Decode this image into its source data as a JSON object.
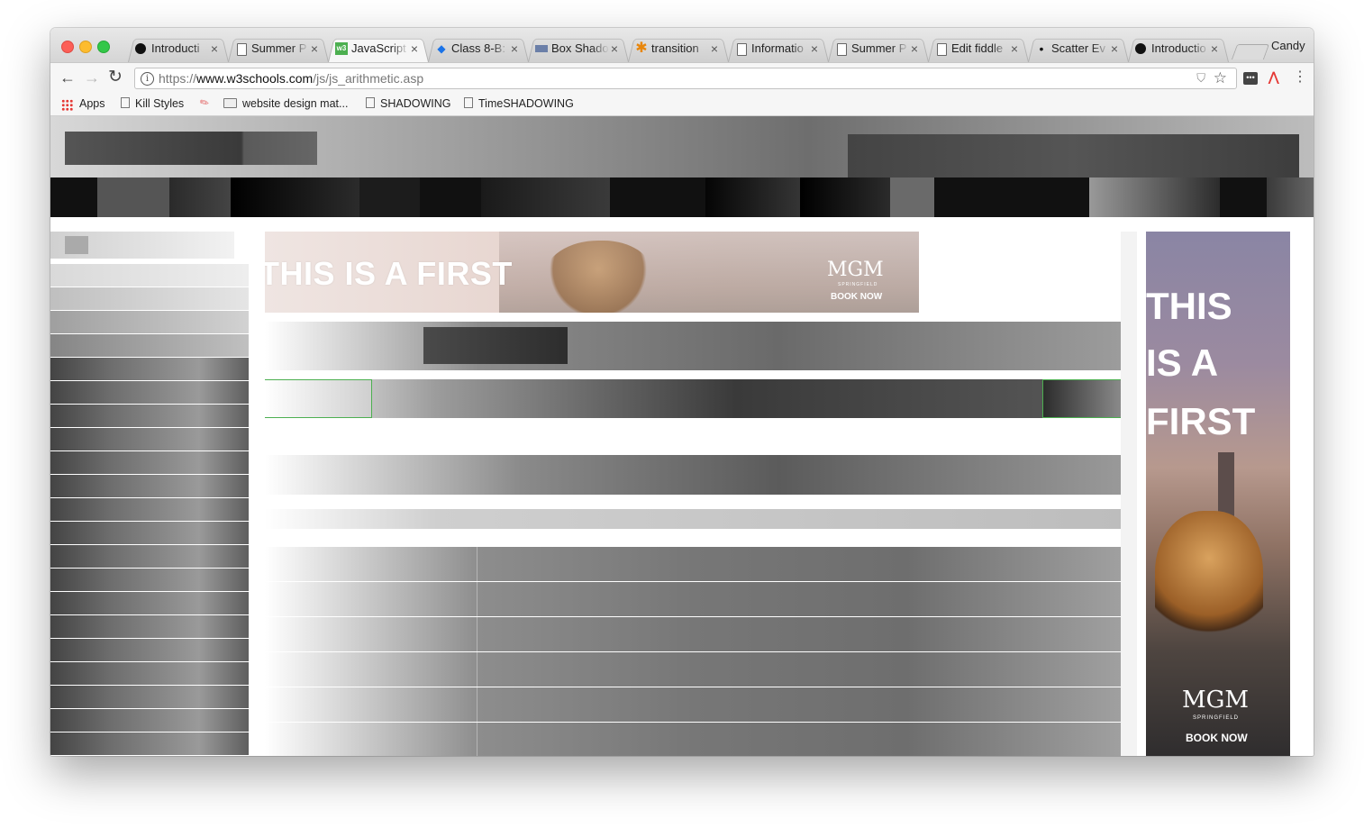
{
  "browser": {
    "tabs": [
      {
        "title": "Introducti",
        "favicon": "dot",
        "active": false
      },
      {
        "title": "Summer P",
        "favicon": "doc",
        "active": false
      },
      {
        "title": "JavaScript",
        "favicon": "w3",
        "active": true
      },
      {
        "title": "Class 8-B:",
        "favicon": "blue",
        "active": false
      },
      {
        "title": "Box Shado",
        "favicon": "box",
        "active": false
      },
      {
        "title": "transition",
        "favicon": "star",
        "active": false
      },
      {
        "title": "Informatio",
        "favicon": "doc",
        "active": false
      },
      {
        "title": "Summer P",
        "favicon": "doc",
        "active": false
      },
      {
        "title": "Edit fiddle",
        "favicon": "doc",
        "active": false
      },
      {
        "title": "Scatter Ev",
        "favicon": "small",
        "active": false
      },
      {
        "title": "Introductio",
        "favicon": "dot",
        "active": false
      }
    ],
    "tab_close": "×",
    "profile_name": "Candy",
    "url_scheme": "https://",
    "url_host": "www.w3schools.com",
    "url_path": "/js/js_arithmetic.asp",
    "info_glyph": "i",
    "star_glyph": "☆",
    "menu_glyph": "⋮",
    "back_glyph": "←",
    "forward_glyph": "→",
    "reload_glyph": "↻",
    "w3_favicon_text": "w3"
  },
  "bookmarks": [
    {
      "label": "Apps",
      "icon": "apps-grid-icon"
    },
    {
      "label": "Kill Styles",
      "icon": "page-icon"
    },
    {
      "label": "website design mat...",
      "icon": "folder-icon"
    },
    {
      "label": "SHADOWING",
      "icon": "page-icon"
    },
    {
      "label": "TimeSHADOWING",
      "icon": "page-icon"
    }
  ],
  "ads": {
    "banner_headline": "THIS IS A FIRST",
    "brand": "MGM",
    "brand_sub": "SPRINGFIELD",
    "cta": "BOOK NOW",
    "sky_line1": "THIS",
    "sky_line2": "IS A",
    "sky_line3": "FIRST"
  },
  "colors": {
    "accent_green": "#4caf50",
    "topnav_bg": "#111111"
  }
}
